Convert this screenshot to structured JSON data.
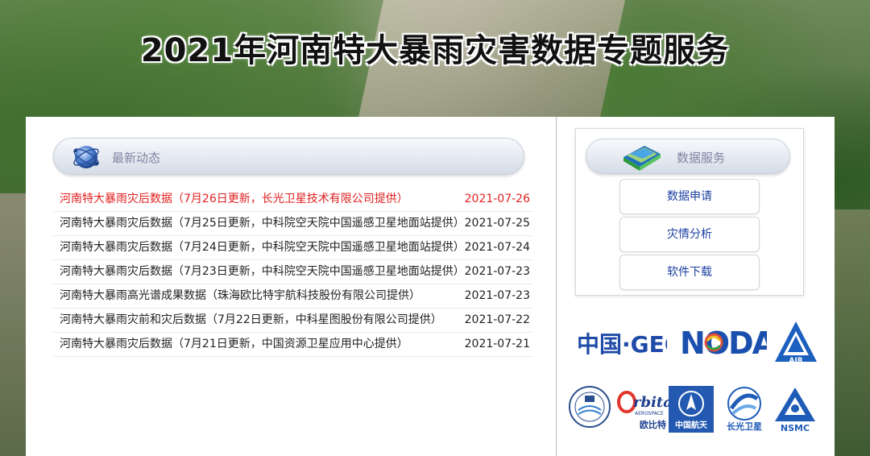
{
  "page": {
    "title": "2021年河南特大暴雨灾害数据专题服务"
  },
  "news": {
    "header": "最新动态",
    "items": [
      {
        "title": "河南特大暴雨灾后数据（7月26日更新，长光卫星技术有限公司提供）",
        "date": "2021-07-26",
        "highlight": true
      },
      {
        "title": "河南特大暴雨灾后数据（7月25日更新，中科院空天院中国遥感卫星地面站提供）",
        "date": "2021-07-25",
        "highlight": false
      },
      {
        "title": "河南特大暴雨灾后数据（7月24日更新，中科院空天院中国遥感卫星地面站提供）",
        "date": "2021-07-24",
        "highlight": false
      },
      {
        "title": "河南特大暴雨灾后数据（7月23日更新，中科院空天院中国遥感卫星地面站提供）",
        "date": "2021-07-23",
        "highlight": false
      },
      {
        "title": "河南特大暴雨高光谱成果数据（珠海欧比特宇航科技股份有限公司提供）",
        "date": "2021-07-23",
        "highlight": false
      },
      {
        "title": "河南特大暴雨灾前和灾后数据（7月22日更新，中科星图股份有限公司提供）",
        "date": "2021-07-22",
        "highlight": false
      },
      {
        "title": "河南特大暴雨灾后数据（7月21日更新，中国资源卫星应用中心提供）",
        "date": "2021-07-21",
        "highlight": false
      }
    ]
  },
  "services": {
    "header": "数据服务",
    "buttons": [
      "数据申请",
      "灾情分析",
      "软件下载"
    ]
  },
  "logos": {
    "china_geo": "中国·GEO",
    "noda": "NODA",
    "air": "AIR",
    "orbita_main": "rbita",
    "orbita_sub": "AEROSPACE",
    "orbita_cn": "欧比特",
    "casc": "中国航天",
    "changguang": "长光卫星",
    "nsmc": "NSMC"
  },
  "colors": {
    "highlight_red": "#e02020",
    "link_blue": "#1a3fa0",
    "header_label": "#7f86a3"
  }
}
